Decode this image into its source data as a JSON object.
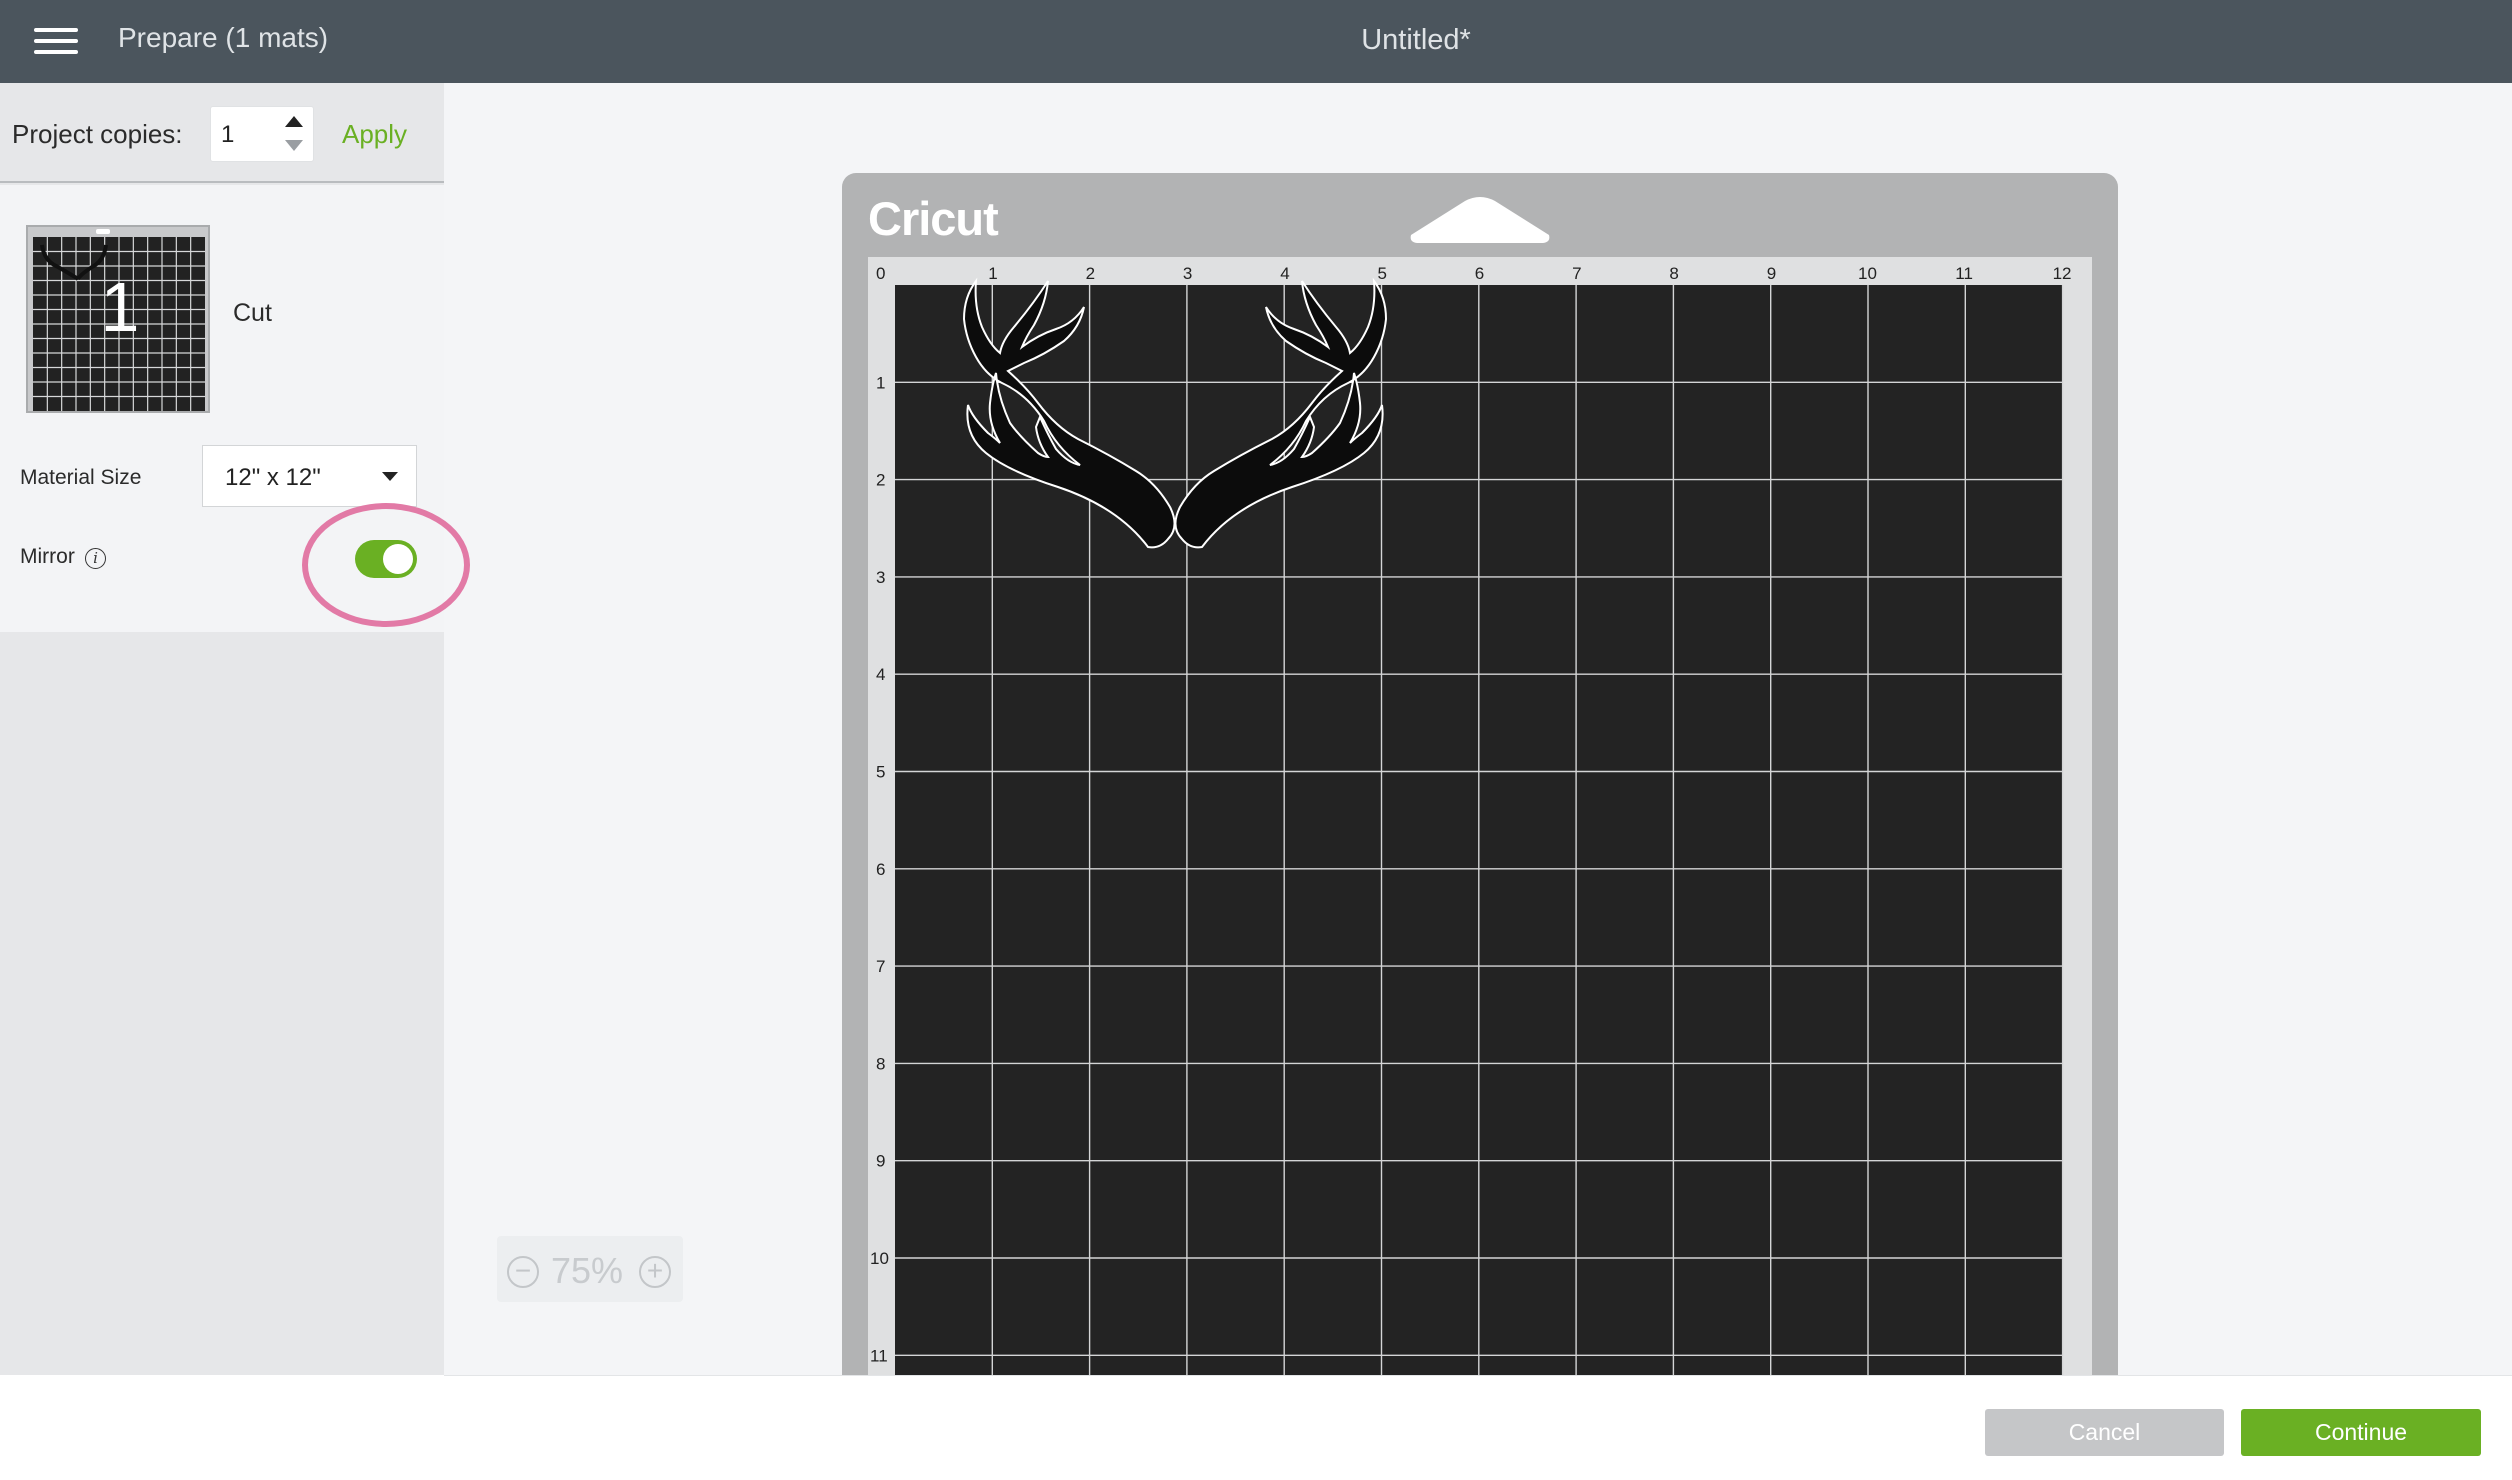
{
  "header": {
    "menu_icon": "hamburger-menu-icon",
    "title": "Prepare (1 mats)",
    "document_title": "Untitled*"
  },
  "sidebar": {
    "project_copies_label": "Project copies:",
    "project_copies_value": "1",
    "apply_label": "Apply",
    "mat_number": "1",
    "mat_type": "Cut",
    "material_size_label": "Material Size",
    "material_size_value": "12\" x 12\"",
    "mirror_label": "Mirror",
    "mirror_on": true,
    "info_icon": "i"
  },
  "canvas": {
    "zoom_level": "75%",
    "zoom_minus": "−",
    "zoom_plus": "+",
    "brand_logo": "Cricut",
    "ruler_x_labels": [
      "0",
      "1",
      "2",
      "3",
      "4",
      "5",
      "6",
      "7",
      "8",
      "9",
      "10",
      "11",
      "12"
    ],
    "ruler_y_labels": [
      "1",
      "2",
      "3",
      "4",
      "5",
      "6",
      "7",
      "8",
      "9",
      "10",
      "11"
    ]
  },
  "footer": {
    "cancel_label": "Cancel",
    "continue_label": "Continue"
  },
  "colors": {
    "header_bg": "#4b555d",
    "accent_green": "#6ab023",
    "highlight_pink": "#e27aa6",
    "mat_grid_bg": "#232323"
  }
}
